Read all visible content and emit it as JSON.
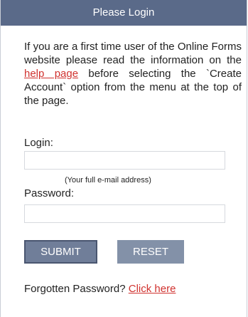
{
  "header": {
    "title": "Please Login"
  },
  "intro": {
    "text_before": "If you are a first time user of the Online Forms website please read the information on the ",
    "link_text": "help page",
    "text_after": " before selecting the `Create Account` option from the menu at the top of the page."
  },
  "login": {
    "label": "Login:",
    "value": "",
    "placeholder": "",
    "hint": "(Your full e-mail address)"
  },
  "password": {
    "label": "Password:",
    "value": "",
    "placeholder": ""
  },
  "buttons": {
    "submit_label": "SUBMIT",
    "reset_label": "RESET"
  },
  "forgot": {
    "text": "Forgotten Password? ",
    "link_text": "Click here"
  },
  "colors": {
    "header_bg": "#5a6a89",
    "button_bg": "#7d8aa2",
    "link": "#d0322f"
  }
}
